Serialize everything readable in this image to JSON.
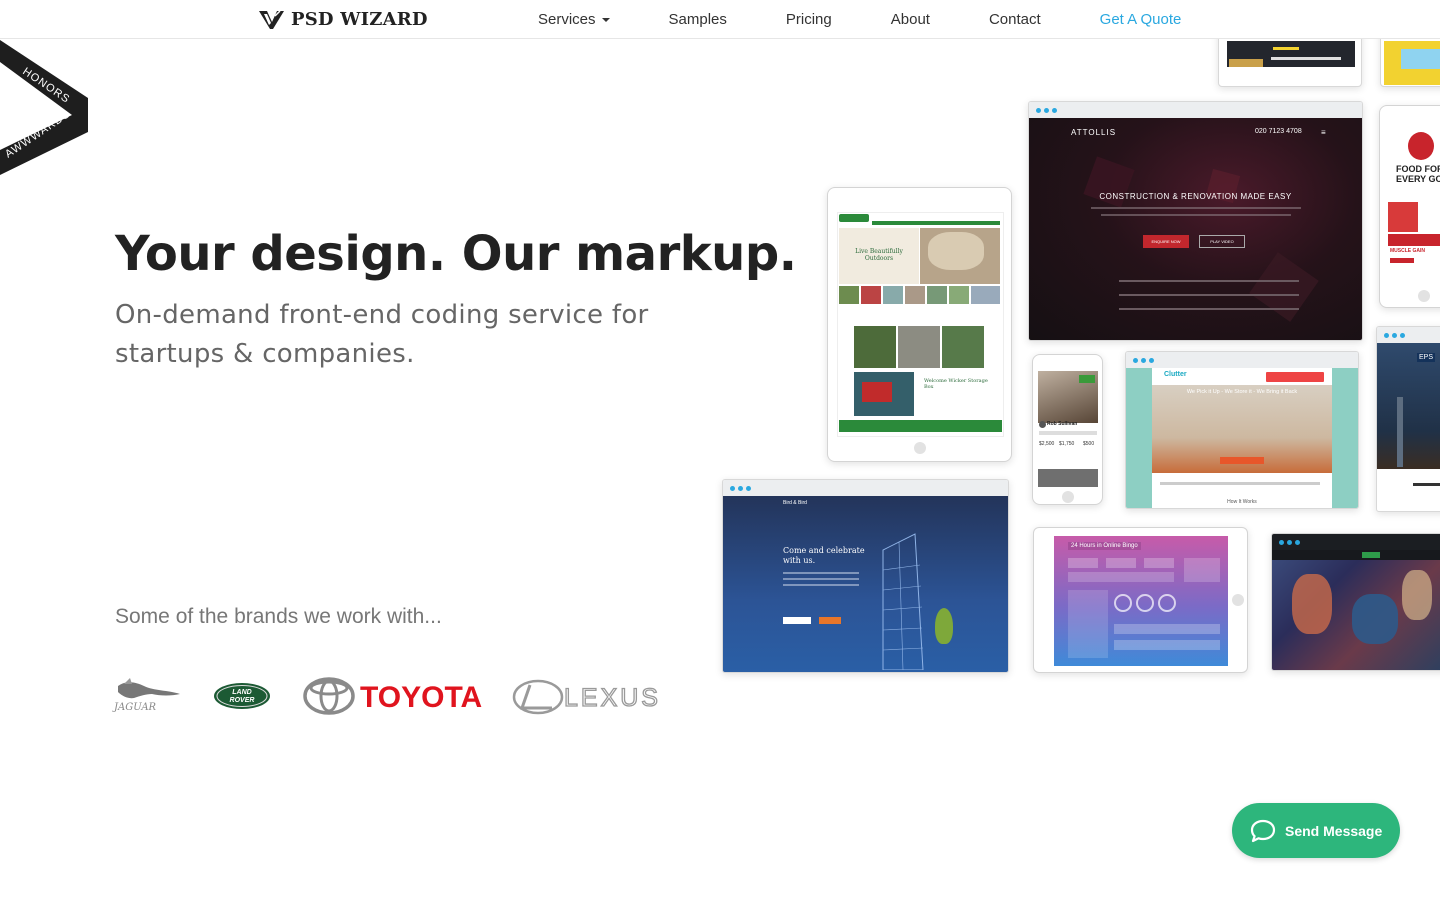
{
  "brand": {
    "name": "PSD WIZARD"
  },
  "nav": {
    "services": "Services",
    "samples": "Samples",
    "pricing": "Pricing",
    "about": "About",
    "contact": "Contact",
    "quote": "Get A Quote"
  },
  "ribbon": {
    "top": "HONORS",
    "bottom": "AWWWARDS"
  },
  "hero": {
    "title": "Your design. Our markup.",
    "subtitle": "On-demand front-end coding service for startups & companies."
  },
  "brands": {
    "heading": "Some of the brands we work with...",
    "items": [
      "JAGUAR",
      "LAND ROVER",
      "TOYOTA",
      "LEXUS"
    ]
  },
  "samples": {
    "attollis": {
      "logo": "ATTOLLIS",
      "phone": "020 7123 4708",
      "headline": "CONSTRUCTION & RENOVATION MADE EASY",
      "cta1": "ENQUIRE NOW",
      "cta2": "PLAY VIDEO"
    },
    "garden": {
      "headline1": "Live Beautifully Outdoors",
      "headline2": "Welcome Wicker Storage Box"
    },
    "clutter": {
      "logo": "Clutter",
      "headline": "We Pick it Up - We Store it - We Bring it Back",
      "footer": "How It Works"
    },
    "profile": {
      "name": "Rob Sullivan",
      "prices": [
        "$2,500",
        "$1,750",
        "$500"
      ]
    },
    "birdbird": {
      "logo": "Bird & Bird",
      "headline": "Come and celebrate with us."
    },
    "bingo": {
      "title": "24 Hours in Online Bingo"
    },
    "food": {
      "headline": "FOOD FOR EVERY GO",
      "sub": "MUSCLE GAIN"
    },
    "eps": {
      "logo": "EPS"
    }
  },
  "chat": {
    "label": "Send Message"
  },
  "colors": {
    "accent": "#2aa8e0",
    "chat": "#2db67c",
    "toyota": "#e0141e"
  }
}
